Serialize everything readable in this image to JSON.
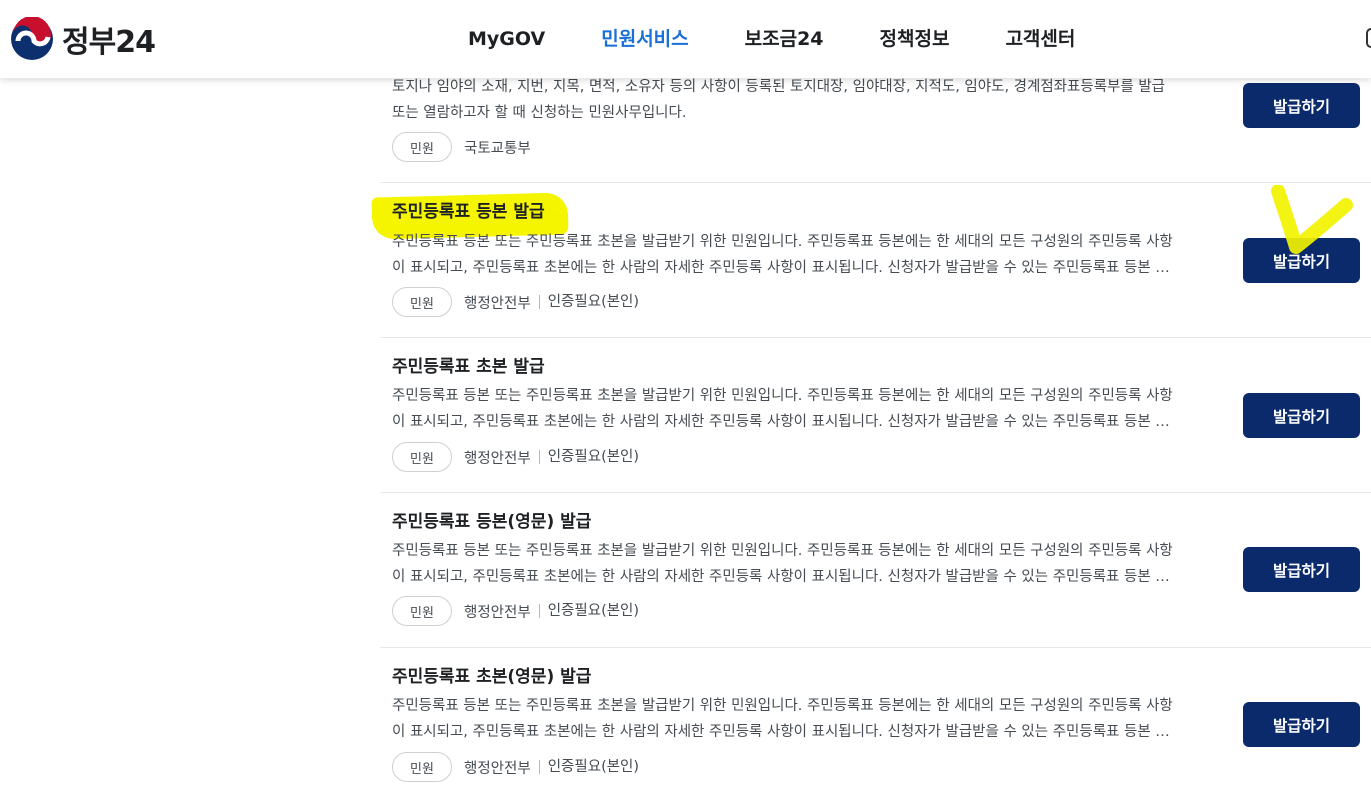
{
  "header": {
    "logo_text": "정부24",
    "nav": [
      "MyGOV",
      "민원서비스",
      "보조금24",
      "정책정보",
      "고객센터"
    ],
    "active_nav": "민원서비스"
  },
  "items": [
    {
      "title": "",
      "desc_lines": [
        "토지나 임야의 소재, 지번, 지목, 면적, 소유자 등의 사항이 등록된 토지대장, 임야대장, 지적도, 임야도, 경계점좌표등록부를 발급",
        "또는 열람하고자 할 때 신청하는 민원사무입니다."
      ],
      "tag": "민원",
      "org": "국토교통부",
      "auth": "",
      "button": "발급하기"
    },
    {
      "title": "주민등록표 등본 발급",
      "desc_lines": [
        "주민등록표 등본 또는 주민등록표 초본을 발급받기 위한 민원입니다. 주민등록표 등본에는 한 세대의 모든 구성원의 주민등록 사항",
        "이 표시되고, 주민등록표 초본에는 한 사람의 자세한 주민등록 사항이 표시됩니다. 신청자가 발급받을 수 있는 주민등록표 등본 …"
      ],
      "tag": "민원",
      "org": "행정안전부",
      "auth": "인증필요(본인)",
      "button": "발급하기"
    },
    {
      "title": "주민등록표 초본 발급",
      "desc_lines": [
        "주민등록표 등본 또는 주민등록표 초본을 발급받기 위한 민원입니다. 주민등록표 등본에는 한 세대의 모든 구성원의 주민등록 사항",
        "이 표시되고, 주민등록표 초본에는 한 사람의 자세한 주민등록 사항이 표시됩니다. 신청자가 발급받을 수 있는 주민등록표 등본 …"
      ],
      "tag": "민원",
      "org": "행정안전부",
      "auth": "인증필요(본인)",
      "button": "발급하기"
    },
    {
      "title": "주민등록표 등본(영문) 발급",
      "desc_lines": [
        "주민등록표 등본 또는 주민등록표 초본을 발급받기 위한 민원입니다. 주민등록표 등본에는 한 세대의 모든 구성원의 주민등록 사항",
        "이 표시되고, 주민등록표 초본에는 한 사람의 자세한 주민등록 사항이 표시됩니다. 신청자가 발급받을 수 있는 주민등록표 등본 …"
      ],
      "tag": "민원",
      "org": "행정안전부",
      "auth": "인증필요(본인)",
      "button": "발급하기"
    },
    {
      "title": "주민등록표 초본(영문) 발급",
      "desc_lines": [
        "주민등록표 등본 또는 주민등록표 초본을 발급받기 위한 민원입니다. 주민등록표 등본에는 한 세대의 모든 구성원의 주민등록 사항",
        "이 표시되고, 주민등록표 초본에는 한 사람의 자세한 주민등록 사항이 표시됩니다. 신청자가 발급받을 수 있는 주민등록표 등본 …"
      ],
      "tag": "민원",
      "org": "행정안전부",
      "auth": "인증필요(본인)",
      "button": "발급하기"
    }
  ],
  "colors": {
    "accent": "#1a6ed8",
    "button": "#0b2a6b",
    "highlight": "#f5f500"
  }
}
